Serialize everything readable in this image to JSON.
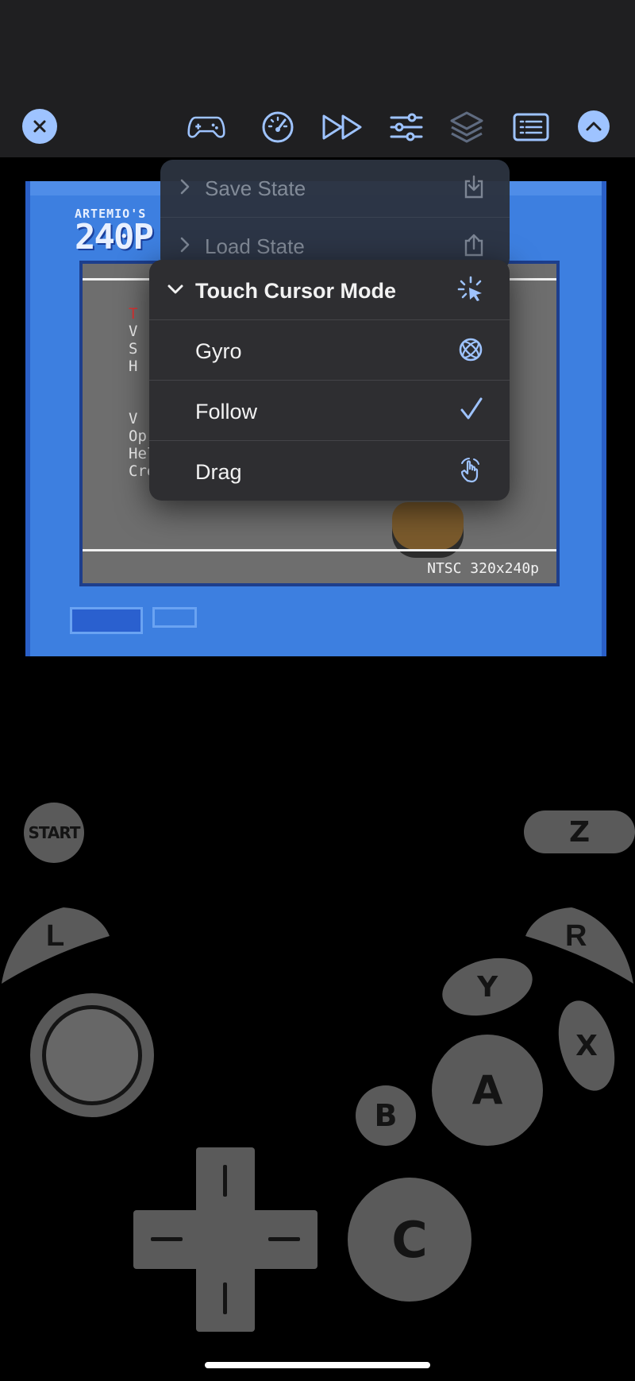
{
  "toolbar": {
    "buttons": [
      {
        "name": "close-button",
        "icon": "close-icon"
      },
      {
        "name": "controller-button",
        "icon": "gamepad-icon"
      },
      {
        "name": "speed-button",
        "icon": "speedometer-icon"
      },
      {
        "name": "fast-forward-button",
        "icon": "fast-forward-icon"
      },
      {
        "name": "settings-button",
        "icon": "sliders-icon"
      },
      {
        "name": "layers-button",
        "icon": "layers-icon"
      },
      {
        "name": "list-button",
        "icon": "list-icon"
      },
      {
        "name": "collapse-button",
        "icon": "chevron-up-icon"
      }
    ],
    "accent": "#9ec3ff"
  },
  "game_screen": {
    "logo_small": "ARTEMIO'S",
    "logo_big": "240P",
    "menu_items": [
      "T",
      "V",
      "S",
      "H",
      "",
      "V",
      "Op",
      "Help",
      "Credits"
    ],
    "resolution": "NTSC 320x240p"
  },
  "state_menu": {
    "items": [
      {
        "label": "Save State",
        "icon": "save-download-icon"
      },
      {
        "label": "Load State",
        "icon": "upload-icon"
      }
    ]
  },
  "cursor_menu": {
    "title": "Touch Cursor Mode",
    "title_icon": "cursor-click-icon",
    "options": [
      {
        "label": "Gyro",
        "icon": "gyro-icon",
        "selected": false
      },
      {
        "label": "Follow",
        "icon": "checkmark-icon",
        "selected": true
      },
      {
        "label": "Drag",
        "icon": "hand-drag-icon",
        "selected": false
      }
    ]
  },
  "controller": {
    "start": "START",
    "z": "Z",
    "l": "L",
    "r": "R",
    "y": "Y",
    "x": "X",
    "a": "A",
    "b": "B",
    "c": "C"
  }
}
